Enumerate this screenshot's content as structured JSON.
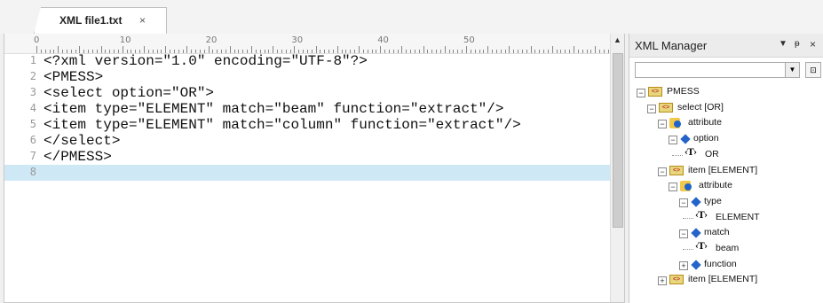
{
  "tab": {
    "title": "XML file1.txt",
    "close": "×"
  },
  "ruler": {
    "marks": [
      "0",
      "10",
      "20",
      "30",
      "40",
      "50"
    ]
  },
  "editor": {
    "lines": [
      {
        "n": "1",
        "text": "<?xml version=\"1.0\" encoding=\"UTF-8\"?>"
      },
      {
        "n": "2",
        "text": "<PMESS>"
      },
      {
        "n": "3",
        "text": "<select option=\"OR\">"
      },
      {
        "n": "4",
        "text": "<item type=\"ELEMENT\" match=\"beam\" function=\"extract\"/>"
      },
      {
        "n": "5",
        "text": "<item type=\"ELEMENT\" match=\"column\" function=\"extract\"/>"
      },
      {
        "n": "6",
        "text": "</select>"
      },
      {
        "n": "7",
        "text": "</PMESS>"
      },
      {
        "n": "8",
        "text": ""
      }
    ],
    "current_line": 8
  },
  "panel": {
    "title": "XML Manager",
    "menu_icon": "▼",
    "pin_icon": "ᵽ",
    "close_icon": "×",
    "filter_value": "",
    "collapse_icon": "⊡"
  },
  "tree": [
    {
      "label": "PMESS",
      "type": "element",
      "expander": "−"
    },
    {
      "label": "select [OR]",
      "type": "element",
      "expander": "−"
    },
    {
      "label": "attribute",
      "type": "attribute",
      "expander": "−"
    },
    {
      "label": "option",
      "type": "property",
      "expander": "−"
    },
    {
      "label": "OR",
      "type": "text",
      "expander": ""
    },
    {
      "label": "item [ELEMENT]",
      "type": "element",
      "expander": "−"
    },
    {
      "label": "attribute",
      "type": "attribute",
      "expander": "−"
    },
    {
      "label": "type",
      "type": "property",
      "expander": "−"
    },
    {
      "label": "ELEMENT",
      "type": "text",
      "expander": ""
    },
    {
      "label": "match",
      "type": "property",
      "expander": "−"
    },
    {
      "label": "beam",
      "type": "text",
      "expander": ""
    },
    {
      "label": "function",
      "type": "property",
      "expander": "+"
    },
    {
      "label": "item [ELEMENT]",
      "type": "element",
      "expander": "+"
    }
  ]
}
